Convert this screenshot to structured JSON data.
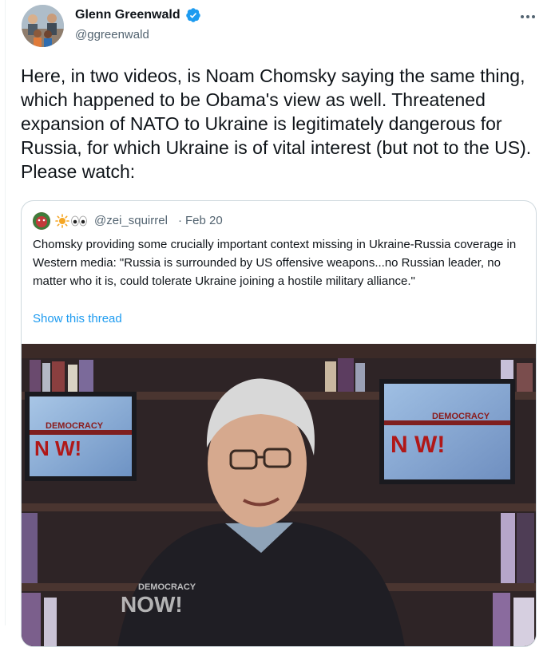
{
  "author": {
    "name": "Glenn Greenwald",
    "handle": "@ggreenwald",
    "verified_icon": "verified-badge-icon",
    "verified_color": "#1d9bf0"
  },
  "more_icon": "more-options-icon",
  "tweet_text": "Here, in two videos, is Noam Chomsky saying the same thing, which happened to be Obama's view as well. Threatened expansion of NATO to Ukraine is legitimately dangerous for Russia, for which Ukraine is of vital interest (but not to the US). Please watch:",
  "quote": {
    "handle": "@zei_squirrel",
    "separator": "·",
    "date": "Feb 20",
    "display_icons": [
      "sun-icon",
      "eyes-icon"
    ],
    "text": "Chomsky providing some crucially important context missing in Ukraine-Russia coverage in Western media: \"Russia is surrounded by US offensive weapons...no Russian leader, no matter who it is, could tolerate Ukraine joining a hostile military alliance.\"",
    "show_thread": "Show this thread",
    "link_color": "#1d9bf0"
  },
  "video": {
    "screen_logo_text_left": "DEMOCRACY",
    "screen_logo_text_right": "DEMOCRACY",
    "logo_word": "N W!",
    "watermark_top": "DEMOCRACY",
    "watermark_bottom": "NOW!"
  }
}
